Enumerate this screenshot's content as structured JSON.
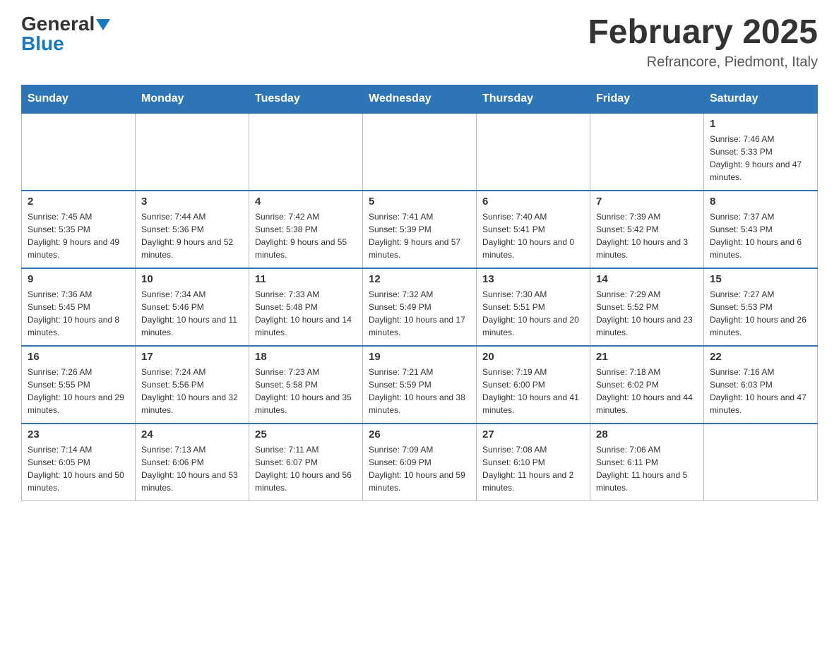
{
  "header": {
    "logo_general": "General",
    "logo_blue": "Blue",
    "month_title": "February 2025",
    "subtitle": "Refrancore, Piedmont, Italy"
  },
  "weekdays": [
    "Sunday",
    "Monday",
    "Tuesday",
    "Wednesday",
    "Thursday",
    "Friday",
    "Saturday"
  ],
  "weeks": [
    [
      {
        "day": "",
        "info": ""
      },
      {
        "day": "",
        "info": ""
      },
      {
        "day": "",
        "info": ""
      },
      {
        "day": "",
        "info": ""
      },
      {
        "day": "",
        "info": ""
      },
      {
        "day": "",
        "info": ""
      },
      {
        "day": "1",
        "info": "Sunrise: 7:46 AM\nSunset: 5:33 PM\nDaylight: 9 hours and 47 minutes."
      }
    ],
    [
      {
        "day": "2",
        "info": "Sunrise: 7:45 AM\nSunset: 5:35 PM\nDaylight: 9 hours and 49 minutes."
      },
      {
        "day": "3",
        "info": "Sunrise: 7:44 AM\nSunset: 5:36 PM\nDaylight: 9 hours and 52 minutes."
      },
      {
        "day": "4",
        "info": "Sunrise: 7:42 AM\nSunset: 5:38 PM\nDaylight: 9 hours and 55 minutes."
      },
      {
        "day": "5",
        "info": "Sunrise: 7:41 AM\nSunset: 5:39 PM\nDaylight: 9 hours and 57 minutes."
      },
      {
        "day": "6",
        "info": "Sunrise: 7:40 AM\nSunset: 5:41 PM\nDaylight: 10 hours and 0 minutes."
      },
      {
        "day": "7",
        "info": "Sunrise: 7:39 AM\nSunset: 5:42 PM\nDaylight: 10 hours and 3 minutes."
      },
      {
        "day": "8",
        "info": "Sunrise: 7:37 AM\nSunset: 5:43 PM\nDaylight: 10 hours and 6 minutes."
      }
    ],
    [
      {
        "day": "9",
        "info": "Sunrise: 7:36 AM\nSunset: 5:45 PM\nDaylight: 10 hours and 8 minutes."
      },
      {
        "day": "10",
        "info": "Sunrise: 7:34 AM\nSunset: 5:46 PM\nDaylight: 10 hours and 11 minutes."
      },
      {
        "day": "11",
        "info": "Sunrise: 7:33 AM\nSunset: 5:48 PM\nDaylight: 10 hours and 14 minutes."
      },
      {
        "day": "12",
        "info": "Sunrise: 7:32 AM\nSunset: 5:49 PM\nDaylight: 10 hours and 17 minutes."
      },
      {
        "day": "13",
        "info": "Sunrise: 7:30 AM\nSunset: 5:51 PM\nDaylight: 10 hours and 20 minutes."
      },
      {
        "day": "14",
        "info": "Sunrise: 7:29 AM\nSunset: 5:52 PM\nDaylight: 10 hours and 23 minutes."
      },
      {
        "day": "15",
        "info": "Sunrise: 7:27 AM\nSunset: 5:53 PM\nDaylight: 10 hours and 26 minutes."
      }
    ],
    [
      {
        "day": "16",
        "info": "Sunrise: 7:26 AM\nSunset: 5:55 PM\nDaylight: 10 hours and 29 minutes."
      },
      {
        "day": "17",
        "info": "Sunrise: 7:24 AM\nSunset: 5:56 PM\nDaylight: 10 hours and 32 minutes."
      },
      {
        "day": "18",
        "info": "Sunrise: 7:23 AM\nSunset: 5:58 PM\nDaylight: 10 hours and 35 minutes."
      },
      {
        "day": "19",
        "info": "Sunrise: 7:21 AM\nSunset: 5:59 PM\nDaylight: 10 hours and 38 minutes."
      },
      {
        "day": "20",
        "info": "Sunrise: 7:19 AM\nSunset: 6:00 PM\nDaylight: 10 hours and 41 minutes."
      },
      {
        "day": "21",
        "info": "Sunrise: 7:18 AM\nSunset: 6:02 PM\nDaylight: 10 hours and 44 minutes."
      },
      {
        "day": "22",
        "info": "Sunrise: 7:16 AM\nSunset: 6:03 PM\nDaylight: 10 hours and 47 minutes."
      }
    ],
    [
      {
        "day": "23",
        "info": "Sunrise: 7:14 AM\nSunset: 6:05 PM\nDaylight: 10 hours and 50 minutes."
      },
      {
        "day": "24",
        "info": "Sunrise: 7:13 AM\nSunset: 6:06 PM\nDaylight: 10 hours and 53 minutes."
      },
      {
        "day": "25",
        "info": "Sunrise: 7:11 AM\nSunset: 6:07 PM\nDaylight: 10 hours and 56 minutes."
      },
      {
        "day": "26",
        "info": "Sunrise: 7:09 AM\nSunset: 6:09 PM\nDaylight: 10 hours and 59 minutes."
      },
      {
        "day": "27",
        "info": "Sunrise: 7:08 AM\nSunset: 6:10 PM\nDaylight: 11 hours and 2 minutes."
      },
      {
        "day": "28",
        "info": "Sunrise: 7:06 AM\nSunset: 6:11 PM\nDaylight: 11 hours and 5 minutes."
      },
      {
        "day": "",
        "info": ""
      }
    ]
  ]
}
